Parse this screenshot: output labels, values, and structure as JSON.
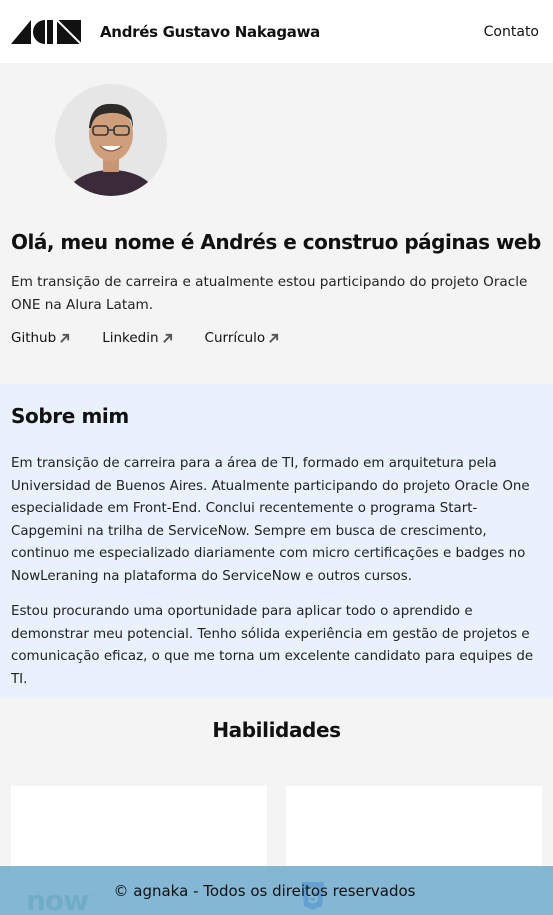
{
  "header": {
    "site_name": "Andrés Gustavo Nakagawa",
    "nav_contact": "Contato",
    "logo_icon": "geometric-logo"
  },
  "hero": {
    "title": "Olá, meu nome é Andrés e construo páginas web",
    "description": "Em transição de carreira e atualmente estou participando do projeto Oracle ONE na Alura Latam.",
    "links": [
      {
        "label": "Github"
      },
      {
        "label": "Linkedin"
      },
      {
        "label": "Currículo"
      }
    ]
  },
  "about": {
    "title": "Sobre mim",
    "paragraph1": "Em transição de carreira para a área de TI, formado em arquitetura pela Universidad de Buenos Aires. Atualmente participando do projeto Oracle One especialidade em Front-End. Conclui recentemente o programa Start-Capgemini na trilha de ServiceNow. Sempre em busca de crescimento, continuo me especializado diariamente com micro certificações e badges no NowLeraning na plataforma do ServiceNow e outros cursos.",
    "paragraph2": "Estou procurando uma oportunidade para aplicar todo o aprendido e demonstrar meu potencial. Tenho sólida experiência em gestão de projetos e comunicação eficaz, o que me torna um excelente candidato para equipes de TI."
  },
  "skills": {
    "title": "Habilidades",
    "cards": [
      {
        "logo_text": "now",
        "logo_tm": "™",
        "icon": "servicenow-logo"
      },
      {
        "icon": "css3-icon"
      }
    ]
  },
  "footer": {
    "text": "© agnaka - Todos os direitos reservados"
  },
  "colors": {
    "about_bg": "#e8f1fc",
    "footer_bg": "#6faacc",
    "page_bg": "#f4f4f4"
  }
}
